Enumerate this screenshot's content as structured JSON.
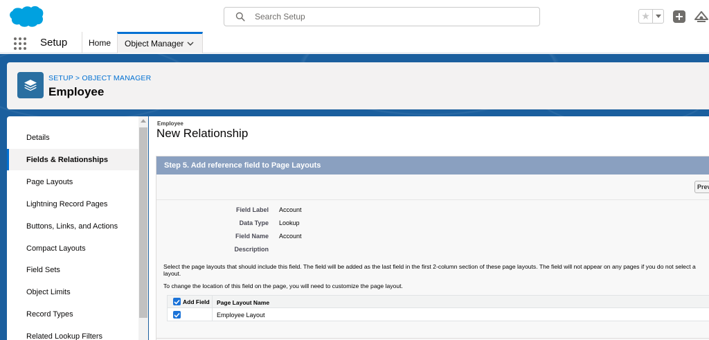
{
  "header": {
    "search_placeholder": "Search Setup",
    "icons": [
      "salesforce-cloud-logo",
      "search-icon",
      "star-icon",
      "caret-down-icon",
      "plus-icon",
      "trailhead-icon"
    ]
  },
  "nav": {
    "app_name": "Setup",
    "tabs": [
      {
        "label": "Home"
      },
      {
        "label": "Object Manager"
      }
    ]
  },
  "object_header": {
    "breadcrumb": "SETUP > OBJECT MANAGER",
    "title": "Employee"
  },
  "sidebar": {
    "items": [
      {
        "label": "Details"
      },
      {
        "label": "Fields & Relationships"
      },
      {
        "label": "Page Layouts"
      },
      {
        "label": "Lightning Record Pages"
      },
      {
        "label": "Buttons, Links, and Actions"
      },
      {
        "label": "Compact Layouts"
      },
      {
        "label": "Field Sets"
      },
      {
        "label": "Object Limits"
      },
      {
        "label": "Record Types"
      },
      {
        "label": "Related Lookup Filters"
      }
    ],
    "active_index": 1
  },
  "main": {
    "eyebrow": "Employee",
    "title": "New Relationship",
    "step_title": "Step 5. Add reference field to Page Layouts",
    "prev_button": "Previous",
    "fields": [
      {
        "label": "Field Label",
        "value": "Account"
      },
      {
        "label": "Data Type",
        "value": "Lookup"
      },
      {
        "label": "Field Name",
        "value": "Account"
      },
      {
        "label": "Description",
        "value": ""
      }
    ],
    "instruction_1": "Select the page layouts that should include this field. The field will be added as the last field in the first 2-column section of these page layouts. The field will not appear on any pages if you do not select a layout.",
    "instruction_2": "To change the location of this field on the page, you will need to customize the page layout.",
    "table": {
      "headers": [
        "Add Field",
        "Page Layout Name"
      ],
      "rows": [
        {
          "checked": true,
          "name": "Employee Layout"
        }
      ],
      "header_checked": true
    }
  },
  "colors": {
    "brand_blue": "#0070d2",
    "step_header": "#8aa0c0",
    "checkbox": "#1b73d8",
    "background_blue": "#1b5f9e"
  }
}
